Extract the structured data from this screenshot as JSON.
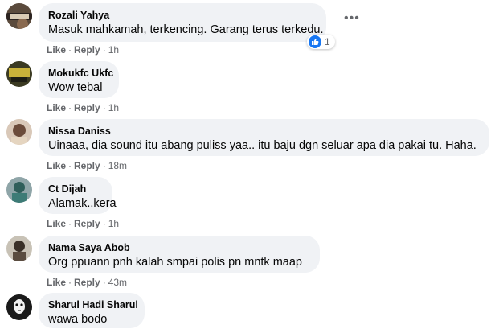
{
  "colors": {
    "bubble": "#f0f2f5",
    "meta": "#65676b",
    "like_blue": "#1877f2"
  },
  "comments": [
    {
      "author": "Rozali Yahya",
      "text": "Masuk mahkamah, terkencing. Garang terus terkedu.",
      "like": "Like",
      "reply": "Reply",
      "time": "1h",
      "reaction_icon": "like-icon",
      "reaction_count": "1",
      "more_icon": "more-options-icon"
    },
    {
      "author": "Mokukfc Ukfc",
      "text": "Wow tebal",
      "like": "Like",
      "reply": "Reply",
      "time": "1h"
    },
    {
      "author": "Nissa Daniss",
      "text": "Uinaaa, dia sound itu abang puliss yaa.. itu baju dgn seluar apa dia pakai tu. Haha.",
      "like": "Like",
      "reply": "Reply",
      "time": "18m"
    },
    {
      "author": "Ct Dijah",
      "text": "Alamak..kera",
      "like": "Like",
      "reply": "Reply",
      "time": "1h"
    },
    {
      "author": "Nama Saya Abob",
      "text": "Org ppuann pnh kalah smpai polis pn mntk maap",
      "like": "Like",
      "reply": "Reply",
      "time": "43m"
    },
    {
      "author": "Sharul Hadi Sharul",
      "text": "wawa bodo"
    }
  ]
}
